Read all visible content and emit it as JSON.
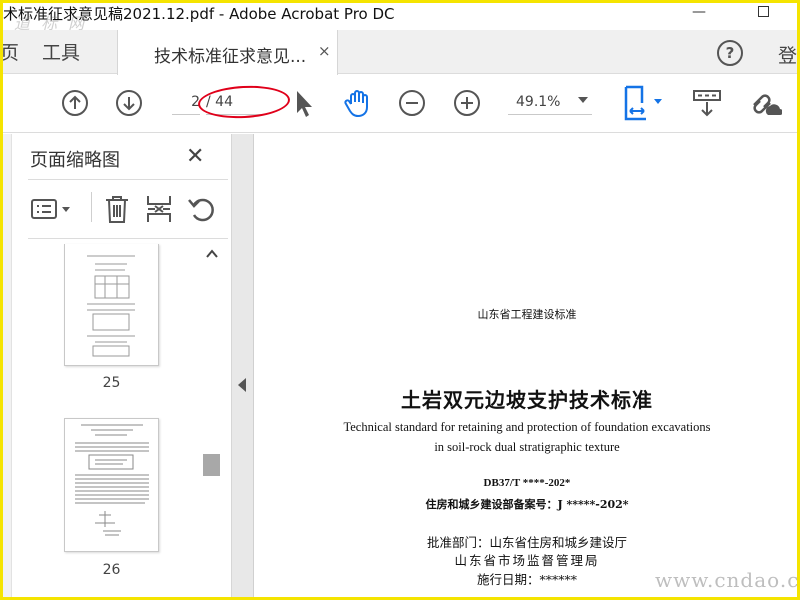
{
  "window": {
    "title": "术标准征求意见稿2021.12.pdf - Adobe Acrobat Pro DC",
    "watermark_top": "道 标 网",
    "minimize_glyph": "—"
  },
  "tabs": {
    "home_label": "页",
    "tools_label": "工具",
    "doc_label": "技术标准征求意见...",
    "close_glyph": "×",
    "help_glyph": "?",
    "login_label": "登"
  },
  "toolbar": {
    "current_page": "2",
    "total_pages": "/ 44",
    "zoom": "49.1%",
    "icons": [
      "arrow-up-icon",
      "arrow-down-icon",
      "pointer-icon",
      "hand-icon",
      "zoom-out-icon",
      "zoom-in-icon",
      "fit-page-icon",
      "scroll-mode-icon",
      "share-link-icon"
    ],
    "accent_color": "#1473e6",
    "annotation_color": "#e0001a"
  },
  "panel": {
    "title": "页面缩略图",
    "close_glyph": "✕",
    "thumbnails": [
      {
        "page_label": "25"
      },
      {
        "page_label": "26"
      }
    ]
  },
  "document": {
    "org": "山东省工程建设标准",
    "title": "土岩双元边坡支护技术标准",
    "english_line1": "Technical standard for retaining and protection of foundation excavations",
    "english_line2": "in soil-rock dual stratigraphic texture",
    "code": "DB37/T ****-202*",
    "record_no": "住房和城乡建设部备案号：J *****-202*",
    "approver": "批准部门：山东省住房和城乡建设厅",
    "approver2": "山东省市场监督管理局",
    "effective_date": "施行日期：******"
  },
  "watermark_bottom": "www.cndao.com"
}
